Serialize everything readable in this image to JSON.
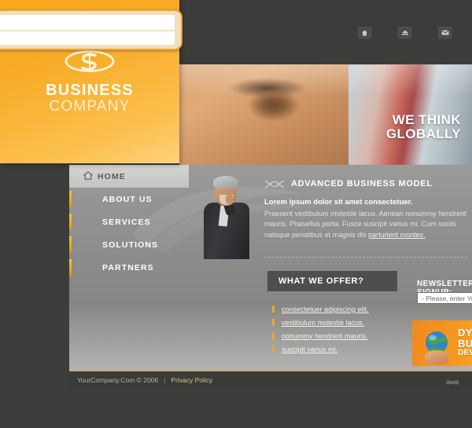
{
  "brand": {
    "logo_icon": "swirl-s-logo-icon",
    "name": "BUSINESS",
    "sub": "COMPANY"
  },
  "header": {
    "icons": [
      {
        "name": "home-icon",
        "label": "Home"
      },
      {
        "name": "sitemap-icon",
        "label": "Site Map"
      },
      {
        "name": "mail-icon",
        "label": "Contact"
      }
    ],
    "blank_field_1": "",
    "blank_field_2": ""
  },
  "hero": {
    "line1": "WE THINK",
    "line2": "GLOBALLY"
  },
  "nav": {
    "items": [
      {
        "label": "HOME",
        "active": true,
        "icon": "house-icon"
      },
      {
        "label": "ABOUT US",
        "active": false
      },
      {
        "label": "SERVICES",
        "active": false
      },
      {
        "label": "SOLUTIONS",
        "active": false
      },
      {
        "label": "PARTNERS",
        "active": false
      }
    ]
  },
  "article": {
    "heading": "ADVANCED BUSINESS MODEL",
    "heading_icon": "chain-link-deco-icon",
    "lead": "Lorem ipsum dolor sit amet consectetuer.",
    "body": "Praesent vestibulum molestie lacus. Aenean nonummy hendrerit mauris. Phasellus porta. Fusce suscipit varius mi. Cum sociis natoque penatibus et magnis dis ",
    "body_link": "parturient montes."
  },
  "offer": {
    "heading": "WHAT WE OFFER?",
    "items": [
      "consectetuer adipiscing elit.",
      "vestibulum molestie lacus.",
      "nonummy hendrerit mauris.",
      "suscipit varius mi."
    ]
  },
  "newsletter": {
    "heading": "NEWSLETTER SIGNUP:",
    "placeholder": "- Please, enter Your e-mail -",
    "value": ""
  },
  "promo": {
    "line1": "DYNAMIC",
    "line2": "BUSINESS",
    "line3": "DEVELOPMENT",
    "icon": "hand-holding-globe-icon",
    "arrow_icon": "chevron-right-icon"
  },
  "footer": {
    "copyright": "YourCompany.Com © 2006",
    "separator": "|",
    "privacy": "Privacy Policy",
    "mark": "▄▃▄"
  },
  "colors": {
    "brand_orange": "#f9a71b",
    "accent_yellow": "#e8a92c",
    "panel_gray": "#8e8e8c",
    "dark_bg": "#3a3a38",
    "link_gold": "#d8c487"
  }
}
